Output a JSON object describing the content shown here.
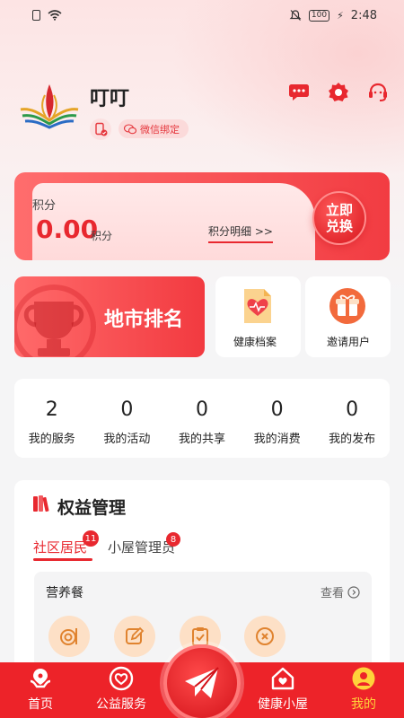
{
  "status_bar": {
    "time": "2:48",
    "battery": "100"
  },
  "profile": {
    "username": "叮叮",
    "wechat_bind_label": "微信绑定"
  },
  "header_icons": [
    "message-icon",
    "settings-icon",
    "customer-service-icon"
  ],
  "points": {
    "title": "积分",
    "value": "0.00",
    "unit": "积分",
    "detail_link": "积分明细 >>",
    "exchange_line1": "立即",
    "exchange_line2": "兑换"
  },
  "quick_tiles": {
    "rank_label": "地市排名",
    "health_record_label": "健康档案",
    "invite_label": "邀请用户"
  },
  "stats": [
    {
      "value": "2",
      "label": "我的服务"
    },
    {
      "value": "0",
      "label": "我的活动"
    },
    {
      "value": "0",
      "label": "我的共享"
    },
    {
      "value": "0",
      "label": "我的消费"
    },
    {
      "value": "0",
      "label": "我的发布"
    }
  ],
  "rights": {
    "title": "权益管理",
    "tabs": [
      {
        "label": "社区居民",
        "badge": "11",
        "active": true
      },
      {
        "label": "小屋管理员",
        "badge": "8",
        "active": false
      }
    ],
    "section_title": "营养餐",
    "more_label": "查看"
  },
  "bottom_nav": [
    {
      "label": "首页",
      "icon": "home-icon",
      "active": false
    },
    {
      "label": "公益服务",
      "icon": "charity-icon",
      "active": false
    },
    {
      "label": "健康小屋",
      "icon": "health-house-icon",
      "active": false
    },
    {
      "label": "我的",
      "icon": "profile-icon",
      "active": true
    }
  ],
  "colors": {
    "primary": "#ed2329",
    "active_nav": "#ffd23a",
    "accent_light": "#fde0c6"
  }
}
